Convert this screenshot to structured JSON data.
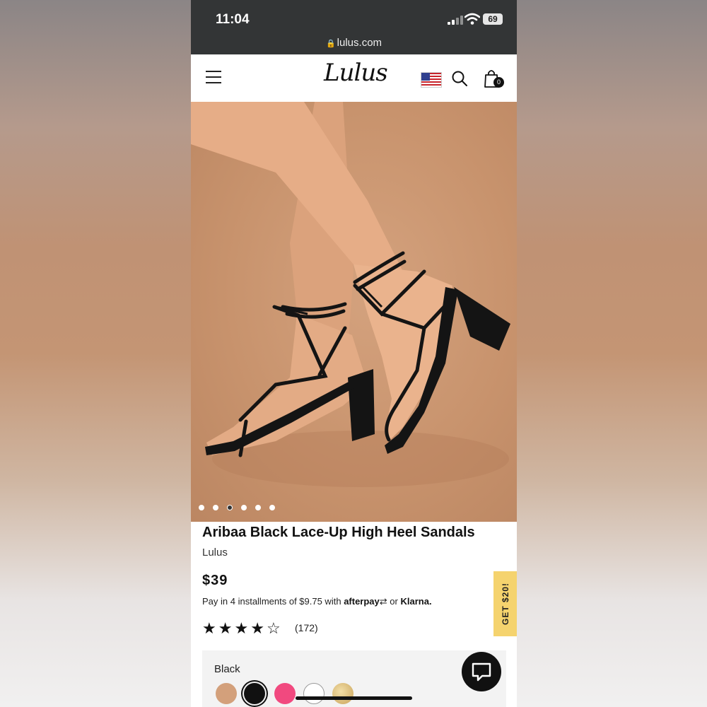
{
  "status_bar": {
    "time": "11:04",
    "battery": "69",
    "url": "lulus.com"
  },
  "header": {
    "logo": "Lulus",
    "cart_count": "0",
    "icons": [
      "menu-icon",
      "us-flag-icon",
      "search-icon",
      "shopping-bag-icon"
    ]
  },
  "gallery": {
    "image_count": 6,
    "active_index": 2,
    "colors": {
      "backdrop": "#c8936d",
      "skin": "#e1a882",
      "sandal": "#141414"
    }
  },
  "product": {
    "title": "Aribaa Black Lace-Up High Heel Sandals",
    "brand": "Lulus",
    "price": "$39",
    "installments_text": "Pay in 4 installments of $9.75 with",
    "afterpay": "afterpay",
    "or_text": "or",
    "klarna": "Klarna.",
    "rating": 4,
    "rating_max": 5,
    "review_count": "(172)"
  },
  "color_selector": {
    "selected_label": "Black",
    "swatches": [
      {
        "name": "nude",
        "color": "#d3a07b",
        "selected": false
      },
      {
        "name": "black",
        "color": "#111111",
        "selected": true
      },
      {
        "name": "pink",
        "color": "#f1497f",
        "selected": false
      },
      {
        "name": "white",
        "color": "#ffffff",
        "selected": false
      },
      {
        "name": "gold",
        "color": "#d9bb78",
        "selected": false
      }
    ]
  },
  "promo": {
    "label": "GET $20!",
    "color": "#f5d36e"
  }
}
